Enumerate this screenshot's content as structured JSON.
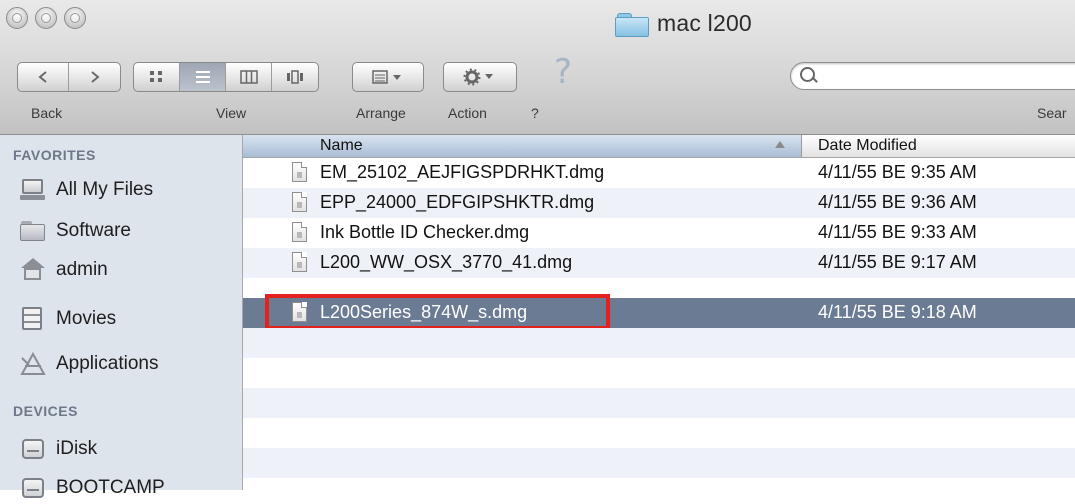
{
  "window": {
    "title": "mac l200"
  },
  "toolbar": {
    "back_label": "Back",
    "view_label": "View",
    "arrange_label": "Arrange",
    "action_label": "Action",
    "help_label": "?",
    "help_glyph": "?",
    "search_label": "Sear",
    "search_value": ""
  },
  "sidebar": {
    "favorites_heading": "FAVORITES",
    "favorites": [
      {
        "label": "All My Files",
        "icon": "all-my-files-icon"
      },
      {
        "label": "Software",
        "icon": "folder-icon"
      },
      {
        "label": "admin",
        "icon": "home-icon"
      },
      {
        "label": "Movies",
        "icon": "movies-icon"
      },
      {
        "label": "Applications",
        "icon": "applications-icon"
      }
    ],
    "devices_heading": "DEVICES",
    "devices": [
      {
        "label": "iDisk",
        "icon": "idisk-icon"
      },
      {
        "label": "BOOTCAMP",
        "icon": "disk-icon"
      }
    ]
  },
  "file_list": {
    "columns": {
      "name": "Name",
      "date_modified": "Date Modified"
    },
    "sort": "name-ascending",
    "files": [
      {
        "name": "EM_25102_AEJFIGSPDRHKT.dmg",
        "date": "4/11/55 BE 9:35 AM",
        "selected": false
      },
      {
        "name": "EPP_24000_EDFGIPSHKTR.dmg",
        "date": "4/11/55 BE 9:36 AM",
        "selected": false
      },
      {
        "name": "Ink Bottle ID Checker.dmg",
        "date": "4/11/55 BE 9:33 AM",
        "selected": false
      },
      {
        "name": "L200_WW_OSX_3770_41.dmg",
        "date": "4/11/55 BE 9:17 AM",
        "selected": false
      },
      {
        "name": "L200Series_874W_s.dmg",
        "date": "4/11/55 BE 9:18 AM",
        "selected": true
      }
    ]
  },
  "colors": {
    "selection": "#6a7b93",
    "highlight_annotation": "#e3211f",
    "sidebar_bg": "#dee4ec",
    "alt_row": "#eef2f8"
  }
}
